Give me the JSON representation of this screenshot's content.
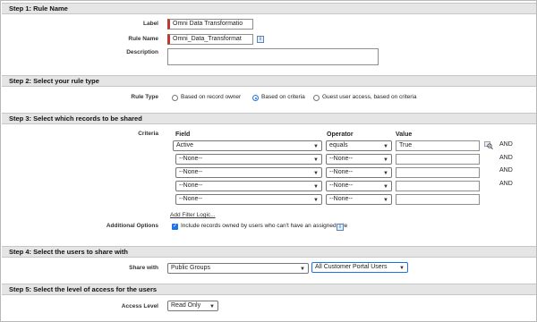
{
  "step1": {
    "title": "Step 1: Rule Name",
    "label_label": "Label",
    "label_value": "Omni Data Transformatio",
    "rulename_label": "Rule Name",
    "rulename_value": "Omni_Data_Transformat",
    "description_label": "Description",
    "description_value": ""
  },
  "step2": {
    "title": "Step 2: Select your rule type",
    "rule_type_label": "Rule Type",
    "options": [
      "Based on record owner",
      "Based on criteria",
      "Guest user access, based on criteria"
    ],
    "selected": "Based on criteria"
  },
  "step3": {
    "title": "Step 3: Select which records to be shared",
    "criteria_label": "Criteria",
    "col_field": "Field",
    "col_operator": "Operator",
    "col_value": "Value",
    "rows": [
      {
        "field": "Active",
        "operator": "equals",
        "value": "True",
        "conj": "AND"
      },
      {
        "field": "--None--",
        "operator": "--None--",
        "value": "",
        "conj": "AND"
      },
      {
        "field": "--None--",
        "operator": "--None--",
        "value": "",
        "conj": "AND"
      },
      {
        "field": "--None--",
        "operator": "--None--",
        "value": "",
        "conj": "AND"
      },
      {
        "field": "--None--",
        "operator": "--None--",
        "value": "",
        "conj": ""
      }
    ],
    "add_filter_logic": "Add Filter Logic...",
    "additional_options_label": "Additional Options",
    "include_option_text": "Include records owned by users who can't have an assigned role",
    "include_option_checked": true
  },
  "step4": {
    "title": "Step 4: Select the users to share with",
    "share_with_label": "Share with",
    "share_with_type": "Public Groups",
    "share_with_target": "All Customer Portal Users"
  },
  "step5": {
    "title": "Step 5: Select the level of access for the users",
    "access_level_label": "Access Level",
    "access_level_value": "Read Only"
  },
  "icons": {
    "info": "info-icon",
    "lookup": "lookup-icon",
    "dropdown": "chevron-down-icon"
  },
  "colors": {
    "required_marker": "#c23934",
    "section_bg": "#e5e5e5",
    "accent": "#1a73e8"
  }
}
